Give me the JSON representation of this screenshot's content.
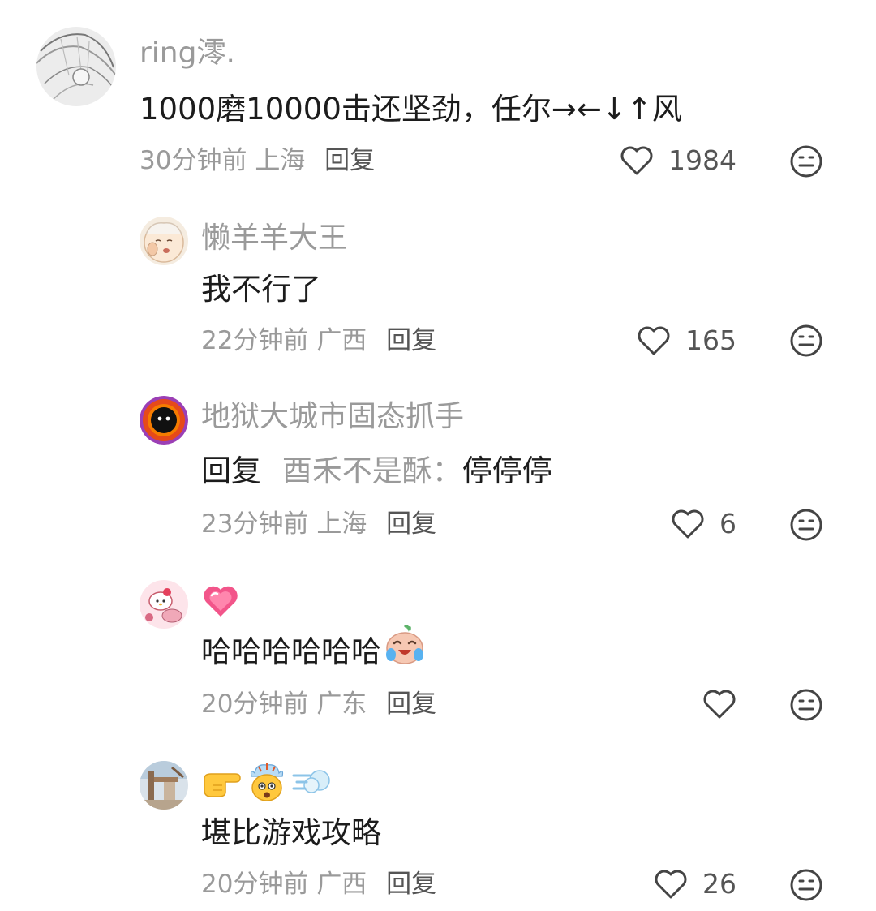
{
  "comments": [
    {
      "username": "ring澪.",
      "text": "1000磨10000击还坚劲，任尔→←↓↑风",
      "time": "30分钟前",
      "location": "上海",
      "reply_label": "回复",
      "likes": "1984",
      "like_icon": "heart-outline-icon",
      "dislike_icon": "meh-face-icon"
    },
    {
      "username": "懒羊羊大王",
      "text": "我不行了",
      "time": "22分钟前",
      "location": "广西",
      "reply_label": "回复",
      "likes": "165"
    },
    {
      "username": "地狱大城市固态抓手",
      "reply_prefix": "回复",
      "reply_to": "酉禾不是酥：",
      "text": "停停停",
      "time": "23分钟前",
      "location": "上海",
      "reply_label": "回复",
      "likes": "6"
    },
    {
      "username_emoji": "pink-sparkle-heart-emoji",
      "text": "哈哈哈哈哈哈",
      "text_emoji": "crying-laughing-baby-emoji",
      "time": "20分钟前",
      "location": "广东",
      "reply_label": "回复",
      "likes": ""
    },
    {
      "username_emojis": [
        "pointing-right-hand-emoji",
        "exploding-head-emoji",
        "dash-wind-emoji"
      ],
      "text": "堪比游戏攻略",
      "time": "20分钟前",
      "location": "广西",
      "reply_label": "回复",
      "likes": "26"
    }
  ]
}
